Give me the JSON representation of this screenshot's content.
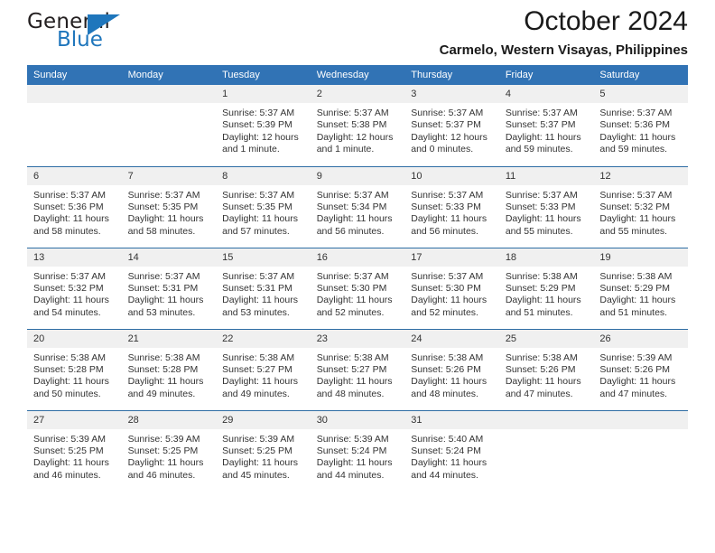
{
  "brand": {
    "name_primary": "General",
    "name_secondary": "Blue",
    "logo_icon": "blue-triangle-logo"
  },
  "header": {
    "title": "October 2024",
    "subtitle": "Carmelo, Western Visayas, Philippines"
  },
  "colors": {
    "header_blue": "#3173b5",
    "row_separator_blue": "#2e6da4",
    "daynum_band": "#f0f0f0",
    "brand_blue": "#1f76bc",
    "text": "#333333"
  },
  "calendar": {
    "weekday_headers": [
      "Sunday",
      "Monday",
      "Tuesday",
      "Wednesday",
      "Thursday",
      "Friday",
      "Saturday"
    ],
    "weeks": [
      [
        {
          "day": "",
          "lines": []
        },
        {
          "day": "",
          "lines": []
        },
        {
          "day": "1",
          "lines": [
            "Sunrise: 5:37 AM",
            "Sunset: 5:39 PM",
            "Daylight: 12 hours and 1 minute."
          ]
        },
        {
          "day": "2",
          "lines": [
            "Sunrise: 5:37 AM",
            "Sunset: 5:38 PM",
            "Daylight: 12 hours and 1 minute."
          ]
        },
        {
          "day": "3",
          "lines": [
            "Sunrise: 5:37 AM",
            "Sunset: 5:37 PM",
            "Daylight: 12 hours and 0 minutes."
          ]
        },
        {
          "day": "4",
          "lines": [
            "Sunrise: 5:37 AM",
            "Sunset: 5:37 PM",
            "Daylight: 11 hours and 59 minutes."
          ]
        },
        {
          "day": "5",
          "lines": [
            "Sunrise: 5:37 AM",
            "Sunset: 5:36 PM",
            "Daylight: 11 hours and 59 minutes."
          ]
        }
      ],
      [
        {
          "day": "6",
          "lines": [
            "Sunrise: 5:37 AM",
            "Sunset: 5:36 PM",
            "Daylight: 11 hours and 58 minutes."
          ]
        },
        {
          "day": "7",
          "lines": [
            "Sunrise: 5:37 AM",
            "Sunset: 5:35 PM",
            "Daylight: 11 hours and 58 minutes."
          ]
        },
        {
          "day": "8",
          "lines": [
            "Sunrise: 5:37 AM",
            "Sunset: 5:35 PM",
            "Daylight: 11 hours and 57 minutes."
          ]
        },
        {
          "day": "9",
          "lines": [
            "Sunrise: 5:37 AM",
            "Sunset: 5:34 PM",
            "Daylight: 11 hours and 56 minutes."
          ]
        },
        {
          "day": "10",
          "lines": [
            "Sunrise: 5:37 AM",
            "Sunset: 5:33 PM",
            "Daylight: 11 hours and 56 minutes."
          ]
        },
        {
          "day": "11",
          "lines": [
            "Sunrise: 5:37 AM",
            "Sunset: 5:33 PM",
            "Daylight: 11 hours and 55 minutes."
          ]
        },
        {
          "day": "12",
          "lines": [
            "Sunrise: 5:37 AM",
            "Sunset: 5:32 PM",
            "Daylight: 11 hours and 55 minutes."
          ]
        }
      ],
      [
        {
          "day": "13",
          "lines": [
            "Sunrise: 5:37 AM",
            "Sunset: 5:32 PM",
            "Daylight: 11 hours and 54 minutes."
          ]
        },
        {
          "day": "14",
          "lines": [
            "Sunrise: 5:37 AM",
            "Sunset: 5:31 PM",
            "Daylight: 11 hours and 53 minutes."
          ]
        },
        {
          "day": "15",
          "lines": [
            "Sunrise: 5:37 AM",
            "Sunset: 5:31 PM",
            "Daylight: 11 hours and 53 minutes."
          ]
        },
        {
          "day": "16",
          "lines": [
            "Sunrise: 5:37 AM",
            "Sunset: 5:30 PM",
            "Daylight: 11 hours and 52 minutes."
          ]
        },
        {
          "day": "17",
          "lines": [
            "Sunrise: 5:37 AM",
            "Sunset: 5:30 PM",
            "Daylight: 11 hours and 52 minutes."
          ]
        },
        {
          "day": "18",
          "lines": [
            "Sunrise: 5:38 AM",
            "Sunset: 5:29 PM",
            "Daylight: 11 hours and 51 minutes."
          ]
        },
        {
          "day": "19",
          "lines": [
            "Sunrise: 5:38 AM",
            "Sunset: 5:29 PM",
            "Daylight: 11 hours and 51 minutes."
          ]
        }
      ],
      [
        {
          "day": "20",
          "lines": [
            "Sunrise: 5:38 AM",
            "Sunset: 5:28 PM",
            "Daylight: 11 hours and 50 minutes."
          ]
        },
        {
          "day": "21",
          "lines": [
            "Sunrise: 5:38 AM",
            "Sunset: 5:28 PM",
            "Daylight: 11 hours and 49 minutes."
          ]
        },
        {
          "day": "22",
          "lines": [
            "Sunrise: 5:38 AM",
            "Sunset: 5:27 PM",
            "Daylight: 11 hours and 49 minutes."
          ]
        },
        {
          "day": "23",
          "lines": [
            "Sunrise: 5:38 AM",
            "Sunset: 5:27 PM",
            "Daylight: 11 hours and 48 minutes."
          ]
        },
        {
          "day": "24",
          "lines": [
            "Sunrise: 5:38 AM",
            "Sunset: 5:26 PM",
            "Daylight: 11 hours and 48 minutes."
          ]
        },
        {
          "day": "25",
          "lines": [
            "Sunrise: 5:38 AM",
            "Sunset: 5:26 PM",
            "Daylight: 11 hours and 47 minutes."
          ]
        },
        {
          "day": "26",
          "lines": [
            "Sunrise: 5:39 AM",
            "Sunset: 5:26 PM",
            "Daylight: 11 hours and 47 minutes."
          ]
        }
      ],
      [
        {
          "day": "27",
          "lines": [
            "Sunrise: 5:39 AM",
            "Sunset: 5:25 PM",
            "Daylight: 11 hours and 46 minutes."
          ]
        },
        {
          "day": "28",
          "lines": [
            "Sunrise: 5:39 AM",
            "Sunset: 5:25 PM",
            "Daylight: 11 hours and 46 minutes."
          ]
        },
        {
          "day": "29",
          "lines": [
            "Sunrise: 5:39 AM",
            "Sunset: 5:25 PM",
            "Daylight: 11 hours and 45 minutes."
          ]
        },
        {
          "day": "30",
          "lines": [
            "Sunrise: 5:39 AM",
            "Sunset: 5:24 PM",
            "Daylight: 11 hours and 44 minutes."
          ]
        },
        {
          "day": "31",
          "lines": [
            "Sunrise: 5:40 AM",
            "Sunset: 5:24 PM",
            "Daylight: 11 hours and 44 minutes."
          ]
        },
        {
          "day": "",
          "lines": []
        },
        {
          "day": "",
          "lines": []
        }
      ]
    ]
  }
}
